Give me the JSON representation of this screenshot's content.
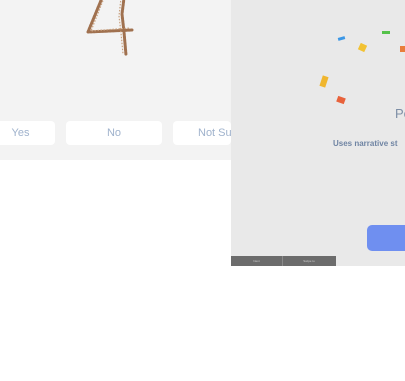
{
  "quiz": {
    "answers": {
      "yes": "Yes",
      "no": "No",
      "not_sure": "Not Su"
    }
  },
  "completion": {
    "title": "Pe",
    "description": "Uses narrative st",
    "bottom_tabs": [
      "Next",
      "Swipe to"
    ]
  },
  "colors": {
    "quiz_background": "#f3f3f3",
    "panel_background": "#e9e9e9",
    "answer_text": "#9fb2cc",
    "primary_button": "#6f8ff0",
    "digit_outline": "#a0714f",
    "confetti": [
      "#3b97e6",
      "#f2c233",
      "#55c24a",
      "#e8623b",
      "#f0b62e",
      "#e8623b",
      "#e87d3b"
    ]
  }
}
